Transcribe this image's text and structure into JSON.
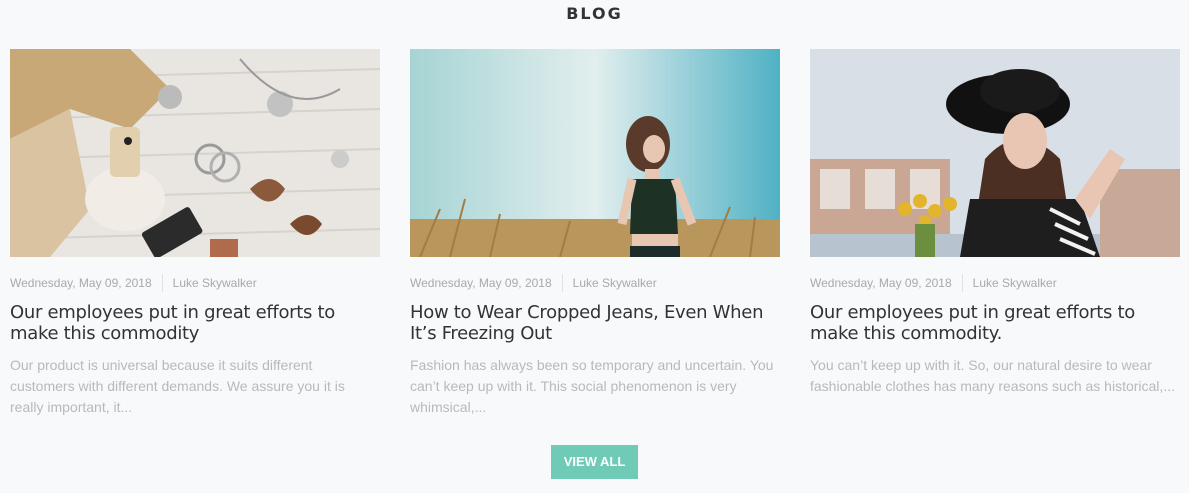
{
  "section": {
    "title": "BLOG"
  },
  "posts": [
    {
      "date": "Wednesday, May 09, 2018",
      "author": "Luke Skywalker",
      "title": "Our employees put in great efforts to make this commodity",
      "excerpt": "Our product is universal because it suits different customers with different demands. We assure you it is really important, it..."
    },
    {
      "date": "Wednesday, May 09, 2018",
      "author": "Luke Skywalker",
      "title": "How to Wear Cropped Jeans, Even When It’s Freezing Out",
      "excerpt": "Fashion has always been so temporary and uncertain. You can’t keep up with it.  This social phenomenon is very whimsical,..."
    },
    {
      "date": "Wednesday, May 09, 2018",
      "author": "Luke Skywalker",
      "title": "Our employees put in great efforts to make this commodity.",
      "excerpt": "You can’t keep up with it. So, our natural desire to wear fashionable clothes has many reasons such as historical,..."
    }
  ],
  "actions": {
    "view_all_label": "VIEW ALL"
  },
  "colors": {
    "accent": "#6fcbb5",
    "muted_text": "#b9b9b9",
    "meta_text": "#a9a9a9"
  }
}
